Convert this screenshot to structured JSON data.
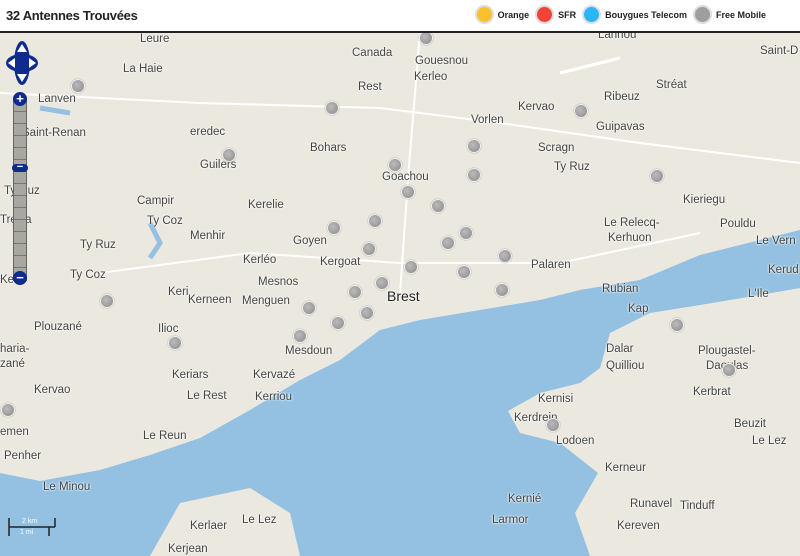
{
  "header": {
    "title": "32 Antennes Trouvées"
  },
  "legend": [
    {
      "label": "Orange",
      "color": "#fbc02d"
    },
    {
      "label": "SFR",
      "color": "#f44336"
    },
    {
      "label": "Bouygues Telecom",
      "color": "#29b6f6"
    },
    {
      "label": "Free Mobile",
      "color": "#9e9e9e"
    }
  ],
  "controls": {
    "zoom_in": "+",
    "zoom_out": "−"
  },
  "scale": {
    "km": "2 km",
    "mi": "1 mi"
  },
  "places": [
    [
      "Leure",
      140,
      0
    ],
    [
      "Canada",
      352,
      14
    ],
    [
      "Gouesnou",
      415,
      22
    ],
    [
      "Lannou",
      598,
      -4
    ],
    [
      "Saint-D",
      760,
      12
    ],
    [
      "La Haie",
      123,
      30
    ],
    [
      "Lanven",
      38,
      60
    ],
    [
      "Rest",
      358,
      48
    ],
    [
      "Kerleo",
      414,
      38
    ],
    [
      "Kervao",
      518,
      68
    ],
    [
      "Ribeuz",
      604,
      58
    ],
    [
      "Stréat",
      656,
      46
    ],
    [
      "Saint-Renan",
      22,
      94
    ],
    [
      "eredec",
      190,
      93
    ],
    [
      "Bohars",
      310,
      109
    ],
    [
      "Vorlen",
      471,
      81
    ],
    [
      "Guipavas",
      596,
      88
    ],
    [
      "Scragn",
      538,
      109
    ],
    [
      "Guilers",
      200,
      126
    ],
    [
      "Ty Ruz",
      554,
      128
    ],
    [
      "Goachou",
      382,
      138
    ],
    [
      "Kieriegu",
      683,
      161
    ],
    [
      "Ty Ruz",
      4,
      152
    ],
    [
      "Campir",
      137,
      162
    ],
    [
      "Ty Coz",
      147,
      182
    ],
    [
      "Kerelie",
      248,
      166
    ],
    [
      "Pouldu",
      720,
      185
    ],
    [
      "Trévia",
      0,
      181
    ],
    [
      "Menhir",
      190,
      197
    ],
    [
      "Goyen",
      293,
      202
    ],
    [
      "Le Relecq-",
      604,
      184
    ],
    [
      "Kerhuon",
      608,
      199
    ],
    [
      "Le Vern",
      756,
      202
    ],
    [
      "Ty Ruz",
      80,
      206
    ],
    [
      "Kerléo",
      243,
      221
    ],
    [
      "Kergoat",
      320,
      223
    ],
    [
      "Palaren",
      531,
      226
    ],
    [
      "Kerud",
      768,
      231
    ],
    [
      "Ty Coz",
      70,
      236
    ],
    [
      "Ke",
      0,
      241
    ],
    [
      "Mesnos",
      258,
      243
    ],
    [
      "Keri",
      168,
      253
    ],
    [
      "Kerneen",
      188,
      261
    ],
    [
      "Menguen",
      242,
      262
    ],
    [
      "Rubian",
      602,
      250
    ],
    [
      "L'Ile",
      748,
      255
    ],
    [
      "Plouzané",
      34,
      288
    ],
    [
      "Ilioc",
      158,
      290
    ],
    [
      "Kap",
      628,
      270
    ],
    [
      "Mesdoun",
      285,
      312
    ],
    [
      "Dalar",
      606,
      310
    ],
    [
      "Plougastel-",
      698,
      312
    ],
    [
      "haria-",
      0,
      310
    ],
    [
      "zané",
      0,
      325
    ],
    [
      "Quilliou",
      606,
      327
    ],
    [
      "Daoulas",
      706,
      327
    ],
    [
      "Keriars",
      172,
      336
    ],
    [
      "Kervazé",
      253,
      336
    ],
    [
      "Kervao",
      34,
      351
    ],
    [
      "Le Rest",
      187,
      357
    ],
    [
      "Kerriou",
      255,
      358
    ],
    [
      "Kerbrat",
      693,
      353
    ],
    [
      "Kernisi",
      538,
      360
    ],
    [
      "emen",
      0,
      393
    ],
    [
      "Kerdrein",
      514,
      379
    ],
    [
      "Lodoen",
      556,
      402
    ],
    [
      "Beuzit",
      734,
      385
    ],
    [
      "Le Reun",
      143,
      397
    ],
    [
      "Le Lez",
      752,
      402
    ],
    [
      "Penher",
      4,
      417
    ],
    [
      "Kerneur",
      605,
      429
    ],
    [
      "Le Minou",
      43,
      448
    ],
    [
      "Kernié",
      508,
      460
    ],
    [
      "Runavel",
      630,
      465
    ],
    [
      "Tinduff",
      680,
      467
    ],
    [
      "Kerlaer",
      190,
      487
    ],
    [
      "Le Lez",
      242,
      481
    ],
    [
      "Larmor",
      492,
      481
    ],
    [
      "Kereven",
      617,
      487
    ],
    [
      "Kerjean",
      168,
      510
    ]
  ],
  "brest_label": "Brest",
  "antennas": [
    [
      426,
      5
    ],
    [
      78,
      53
    ],
    [
      332,
      75
    ],
    [
      581,
      78
    ],
    [
      474,
      113
    ],
    [
      229,
      122
    ],
    [
      395,
      132
    ],
    [
      474,
      142
    ],
    [
      657,
      143
    ],
    [
      408,
      159
    ],
    [
      438,
      173
    ],
    [
      375,
      188
    ],
    [
      334,
      195
    ],
    [
      466,
      200
    ],
    [
      448,
      210
    ],
    [
      369,
      216
    ],
    [
      505,
      223
    ],
    [
      411,
      234
    ],
    [
      464,
      239
    ],
    [
      382,
      250
    ],
    [
      355,
      259
    ],
    [
      502,
      257
    ],
    [
      107,
      268
    ],
    [
      309,
      275
    ],
    [
      367,
      280
    ],
    [
      338,
      290
    ],
    [
      300,
      303
    ],
    [
      175,
      310
    ],
    [
      677,
      292
    ],
    [
      729,
      337
    ],
    [
      8,
      377
    ],
    [
      553,
      392
    ]
  ]
}
